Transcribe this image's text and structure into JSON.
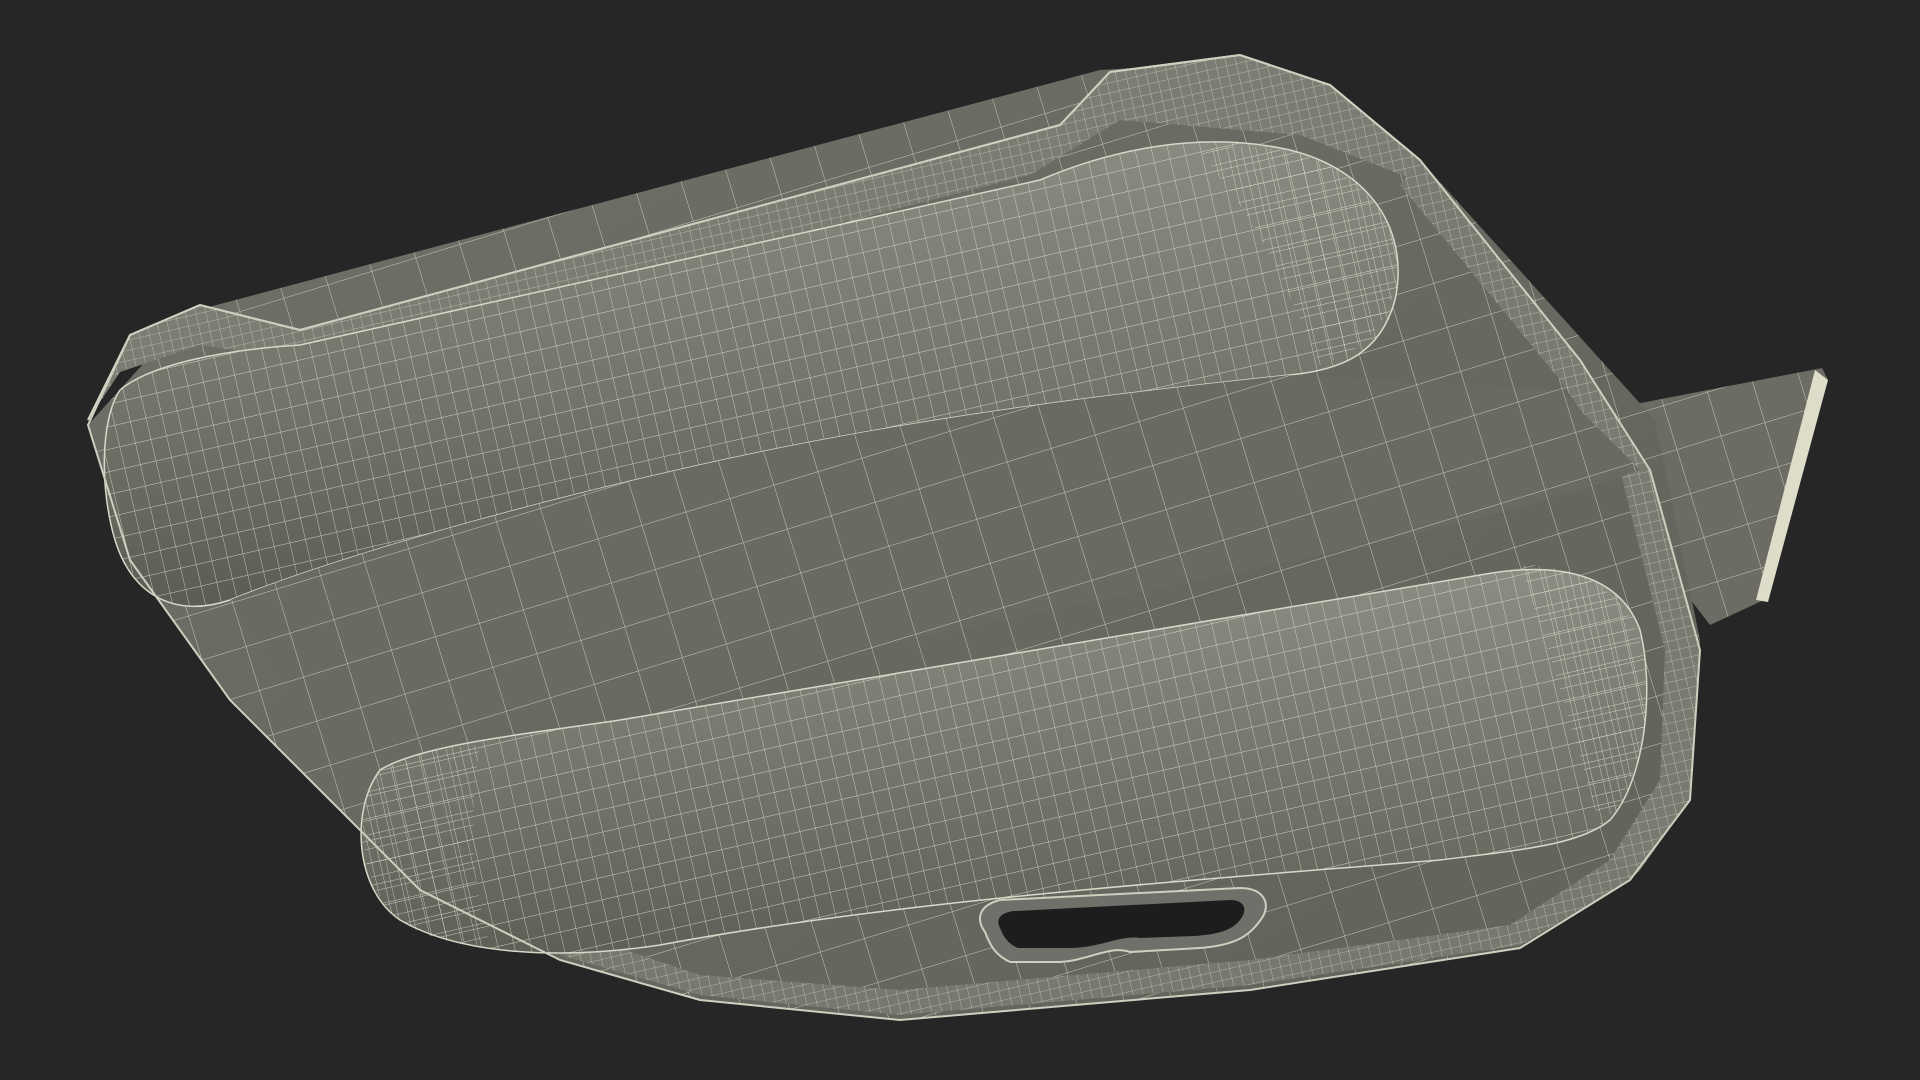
{
  "scene": {
    "subject": "wireframe-3d-model",
    "colors": {
      "background": "#262626",
      "surface": "#6f6f66",
      "surface_light": "#85857b",
      "surface_dark": "#5a5a52",
      "wire": "#e9e9dc",
      "outline": "#c9c9bb"
    }
  }
}
